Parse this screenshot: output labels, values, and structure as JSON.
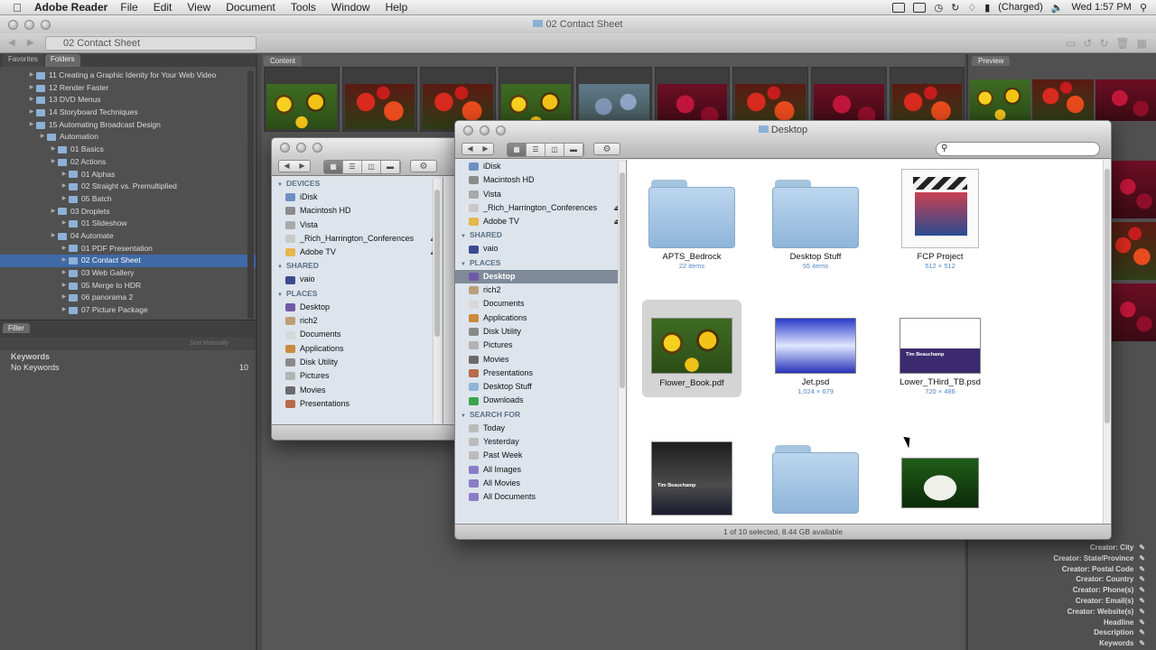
{
  "menubar": {
    "app_name": "Adobe Reader",
    "menus": [
      "File",
      "Edit",
      "View",
      "Document",
      "Tools",
      "Window",
      "Help"
    ],
    "battery_status": "(Charged)",
    "clock": "Wed 1:57 PM"
  },
  "bridge": {
    "window_title": "02 Contact Sheet",
    "path_field": "02 Contact Sheet",
    "left_tabs": [
      "Favorites",
      "Folders"
    ],
    "folders": [
      {
        "label": "11 Creating a Graphic Idenity for Your Web Video",
        "indent": 1
      },
      {
        "label": "12 Render Faster",
        "indent": 1
      },
      {
        "label": "13 DVD Menus",
        "indent": 1
      },
      {
        "label": "14 Storyboard Techniques",
        "indent": 1
      },
      {
        "label": "15 Automating Broadcast Design",
        "indent": 1
      },
      {
        "label": "Automation",
        "indent": 2
      },
      {
        "label": "01 Basics",
        "indent": 3
      },
      {
        "label": "02 Actions",
        "indent": 3
      },
      {
        "label": "01 Alphas",
        "indent": 4
      },
      {
        "label": "02 Straight vs. Premultiplied",
        "indent": 4
      },
      {
        "label": "05 Batch",
        "indent": 4
      },
      {
        "label": "03 Droplets",
        "indent": 3
      },
      {
        "label": "01 Slideshow",
        "indent": 4
      },
      {
        "label": "04 Automate",
        "indent": 3
      },
      {
        "label": "01 PDF Presentation",
        "indent": 4
      },
      {
        "label": "02 Contact Sheet",
        "indent": 4,
        "selected": true
      },
      {
        "label": "03 Web Gallery",
        "indent": 4
      },
      {
        "label": "05 Merge to HDR",
        "indent": 4
      },
      {
        "label": "06 panorama 2",
        "indent": 4
      },
      {
        "label": "07 Picture Package",
        "indent": 4
      }
    ],
    "filter_tab": "Filter",
    "sort_label": "Sort Manually",
    "keywords_heading": "Keywords",
    "no_keywords_label": "No Keywords",
    "no_keywords_count": "10",
    "content_tab": "Content",
    "preview_tab": "Preview",
    "content_thumbs": [
      "sun",
      "red",
      "red",
      "sun",
      "blue",
      "mag",
      "red",
      "mag",
      "red"
    ],
    "metadata_fields": [
      "Creator: City",
      "Creator: State/Province",
      "Creator: Postal Code",
      "Creator: Country",
      "Creator: Phone(s)",
      "Creator: Email(s)",
      "Creator: Website(s)",
      "Headline",
      "Description",
      "Keywords"
    ]
  },
  "finder_back": {
    "devices_heading": "Devices",
    "devices": [
      {
        "label": "iDisk",
        "icon": "idisk-icon",
        "color": "#6e8fc4"
      },
      {
        "label": "Macintosh HD",
        "icon": "hard-drive-icon",
        "color": "#8b8b8b"
      },
      {
        "label": "Vista",
        "icon": "disk-icon",
        "color": "#a9a9a9"
      },
      {
        "label": "_Rich_Harrington_Conferences",
        "icon": "disk-icon",
        "color": "#c9c9c9",
        "eject": "⏏"
      },
      {
        "label": "Adobe TV",
        "icon": "disk-icon",
        "color": "#e6b74a",
        "eject": "⏏"
      }
    ],
    "shared_heading": "Shared",
    "shared": [
      {
        "label": "vaio",
        "icon": "computer-icon",
        "color": "#3a4c8f"
      }
    ],
    "places_heading": "Places",
    "places": [
      {
        "label": "Desktop",
        "icon": "desktop-icon",
        "color": "#6f5aa8"
      },
      {
        "label": "rich2",
        "icon": "home-icon",
        "color": "#b9a07a"
      },
      {
        "label": "Documents",
        "icon": "documents-icon",
        "color": "#d8d8d8"
      },
      {
        "label": "Applications",
        "icon": "applications-icon",
        "color": "#c98a3c"
      },
      {
        "label": "Disk Utility",
        "icon": "disk-utility-icon",
        "color": "#8a8a8a"
      },
      {
        "label": "Pictures",
        "icon": "pictures-icon",
        "color": "#b3b3b3"
      },
      {
        "label": "Movies",
        "icon": "movies-icon",
        "color": "#6a6a6a"
      },
      {
        "label": "Presentations",
        "icon": "presentations-icon",
        "color": "#b86a4a"
      }
    ]
  },
  "finder_front": {
    "window_title": "Desktop",
    "search_placeholder": "",
    "devices": [
      {
        "label": "iDisk",
        "icon": "idisk-icon",
        "color": "#6e8fc4"
      },
      {
        "label": "Macintosh HD",
        "icon": "hard-drive-icon",
        "color": "#8b8b8b"
      },
      {
        "label": "Vista",
        "icon": "disk-icon",
        "color": "#a9a9a9"
      },
      {
        "label": "_Rich_Harrington_Conferences",
        "icon": "disk-icon",
        "color": "#c9c9c9",
        "eject": "⏏"
      },
      {
        "label": "Adobe TV",
        "icon": "disk-icon",
        "color": "#e6b74a",
        "eject": "⏏"
      }
    ],
    "shared_heading": "Shared",
    "shared": [
      {
        "label": "vaio",
        "icon": "computer-icon",
        "color": "#3a4c8f"
      }
    ],
    "places_heading": "Places",
    "places": [
      {
        "label": "Desktop",
        "icon": "desktop-icon",
        "color": "#6f5aa8",
        "selected": true
      },
      {
        "label": "rich2",
        "icon": "home-icon",
        "color": "#b9a07a"
      },
      {
        "label": "Documents",
        "icon": "documents-icon",
        "color": "#d8d8d8"
      },
      {
        "label": "Applications",
        "icon": "applications-icon",
        "color": "#c98a3c"
      },
      {
        "label": "Disk Utility",
        "icon": "disk-utility-icon",
        "color": "#8a8a8a"
      },
      {
        "label": "Pictures",
        "icon": "pictures-icon",
        "color": "#b3b3b3"
      },
      {
        "label": "Movies",
        "icon": "movies-icon",
        "color": "#6a6a6a"
      },
      {
        "label": "Presentations",
        "icon": "presentations-icon",
        "color": "#b86a4a"
      },
      {
        "label": "Desktop Stuff",
        "icon": "folder-icon",
        "color": "#8fb5d9"
      },
      {
        "label": "Downloads",
        "icon": "downloads-icon",
        "color": "#3aa54a"
      }
    ],
    "search_for_heading": "Search For",
    "search_for": [
      {
        "label": "Today",
        "icon": "clock-icon",
        "color": "#bbbbbb"
      },
      {
        "label": "Yesterday",
        "icon": "clock-icon",
        "color": "#bbbbbb"
      },
      {
        "label": "Past Week",
        "icon": "clock-icon",
        "color": "#bbbbbb"
      },
      {
        "label": "All Images",
        "icon": "smart-folder-icon",
        "color": "#8b7cc8"
      },
      {
        "label": "All Movies",
        "icon": "smart-folder-icon",
        "color": "#8b7cc8"
      },
      {
        "label": "All Documents",
        "icon": "smart-folder-icon",
        "color": "#8b7cc8"
      }
    ],
    "files": [
      {
        "name": "APTS_Bedrock",
        "sub": "22 items",
        "kind": "folder"
      },
      {
        "name": "Desktop Stuff",
        "sub": "55 items",
        "kind": "folder"
      },
      {
        "name": "FCP Project",
        "sub": "512 × 512",
        "kind": "fcp"
      },
      {
        "name": "Flower_Book.pdf",
        "sub": "",
        "kind": "pdf",
        "selected": true
      },
      {
        "name": "Jet.psd",
        "sub": "1,024 × 679",
        "kind": "jet"
      },
      {
        "name": "Lower_THird_TB.psd",
        "sub": "720 × 486",
        "kind": "lower"
      },
      {
        "name": "",
        "sub": "",
        "kind": "dark"
      },
      {
        "name": "",
        "sub": "",
        "kind": "folder"
      },
      {
        "name": "",
        "sub": "",
        "kind": "cat"
      }
    ],
    "lower_third_text": "Tim Beauchamp",
    "status": "1 of 10 selected, 8.44 GB available"
  }
}
